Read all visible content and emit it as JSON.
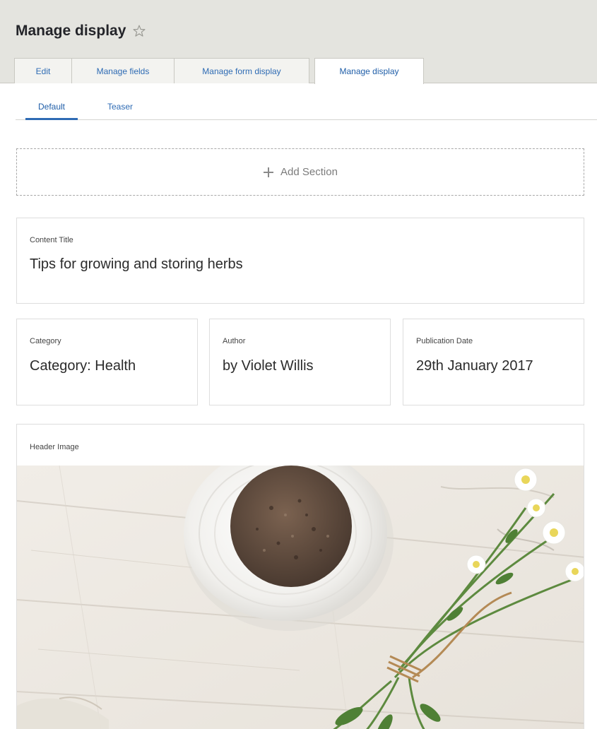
{
  "page": {
    "title": "Manage display"
  },
  "tabs": [
    {
      "label": "Edit",
      "active": false
    },
    {
      "label": "Manage fields",
      "active": false
    },
    {
      "label": "Manage form display",
      "active": false
    },
    {
      "label": "Manage display",
      "active": true
    }
  ],
  "subtabs": [
    {
      "label": "Default",
      "active": true
    },
    {
      "label": "Teaser",
      "active": false
    }
  ],
  "add_section": {
    "label": "Add Section"
  },
  "blocks": {
    "content_title": {
      "label": "Content Title",
      "value": "Tips for growing and storing herbs"
    },
    "category": {
      "label": "Category",
      "value": "Category: Health"
    },
    "author": {
      "label": "Author",
      "value": "by Violet Willis"
    },
    "publication_date": {
      "label": "Publication Date",
      "value": "29th January 2017"
    },
    "header_image": {
      "label": "Header Image"
    }
  },
  "colors": {
    "header_bg": "#e4e4df",
    "link_blue": "#2e6bb4",
    "border": "#dedede"
  }
}
